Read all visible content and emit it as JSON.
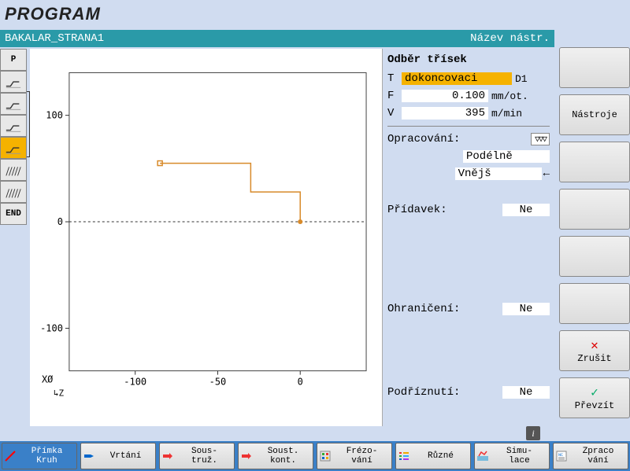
{
  "app_title": "PROGRAM",
  "header": {
    "file": "BAKALAR_STRANA1",
    "right": "Název nástr."
  },
  "left_tools": [
    {
      "name": "p",
      "label": "P",
      "sel": false,
      "type": "text"
    },
    {
      "name": "cut1",
      "sel": false,
      "type": "cut"
    },
    {
      "name": "cut2",
      "sel": false,
      "type": "cut"
    },
    {
      "name": "cut3",
      "sel": false,
      "type": "cut"
    },
    {
      "name": "cut4",
      "sel": true,
      "type": "cut"
    },
    {
      "name": "hatch1",
      "sel": false,
      "type": "hatch"
    },
    {
      "name": "hatch2",
      "sel": false,
      "type": "hatch"
    },
    {
      "name": "end",
      "label": "END",
      "sel": false,
      "type": "text"
    }
  ],
  "params": {
    "title": "Odběr třísek",
    "T_lbl": "T",
    "T_val": "dokoncovaci",
    "T_d": "D1",
    "F_lbl": "F",
    "F_val": "0.100",
    "F_unit": "mm/ot.",
    "V_lbl": "V",
    "V_val": "395",
    "V_unit": "m/min",
    "machining_lbl": "Opracování:",
    "finish_sym": "▽▽▽",
    "dir1": "Podélně",
    "dir2": "Vnějš",
    "allow_lbl": "Přídavek:",
    "allow_val": "Ne",
    "limit_lbl": "Ohraničení:",
    "limit_val": "Ne",
    "undercut_lbl": "Podříznutí:",
    "undercut_val": "Ne"
  },
  "right_keys": [
    {
      "name": "sk1",
      "label": ""
    },
    {
      "name": "sk-tools",
      "label": "Nástroje"
    },
    {
      "name": "sk3",
      "label": ""
    },
    {
      "name": "sk4",
      "label": ""
    },
    {
      "name": "sk5",
      "label": ""
    },
    {
      "name": "sk6",
      "label": ""
    },
    {
      "name": "sk-cancel",
      "label": "Zrušit",
      "icon": "x"
    },
    {
      "name": "sk-accept",
      "label": "Převzít",
      "icon": "check"
    }
  ],
  "bottom_keys": [
    {
      "name": "bk-line",
      "l1": "Přímka",
      "l2": "Kruh",
      "sel": true,
      "icon": "line"
    },
    {
      "name": "bk-drill",
      "l1": "Vrtání",
      "l2": "",
      "icon": "drill"
    },
    {
      "name": "bk-turn",
      "l1": "Sous-",
      "l2": "truž.",
      "icon": "turn"
    },
    {
      "name": "bk-cont",
      "l1": "Soust.",
      "l2": "kont.",
      "icon": "turn"
    },
    {
      "name": "bk-mill",
      "l1": "Frézo-",
      "l2": "vání",
      "icon": "mill"
    },
    {
      "name": "bk-misc",
      "l1": "Různé",
      "l2": "",
      "icon": "misc"
    },
    {
      "name": "bk-sim",
      "l1": "Simu-",
      "l2": "lace",
      "icon": "sim"
    },
    {
      "name": "bk-proc",
      "l1": "Zpraco",
      "l2": "vání",
      "icon": "proc"
    }
  ],
  "chart_data": {
    "type": "line",
    "title": "",
    "xlabel": "Z",
    "ylabel": "XØ",
    "xlim": [
      -140,
      40
    ],
    "ylim": [
      -140,
      140
    ],
    "xticks": [
      -100,
      -50,
      0
    ],
    "yticks": [
      -100,
      0,
      100
    ],
    "series": [
      {
        "name": "toolpath",
        "x": [
          -85,
          -30,
          -30,
          0,
          0
        ],
        "y": [
          55,
          55,
          28,
          28,
          0
        ],
        "color": "#d88a2a"
      }
    ],
    "markers": [
      {
        "x": -85,
        "y": 55,
        "shape": "square",
        "color": "#d88a2a"
      },
      {
        "x": 0,
        "y": 0,
        "shape": "circle",
        "color": "#d88a2a"
      }
    ]
  },
  "info_icon": "i"
}
